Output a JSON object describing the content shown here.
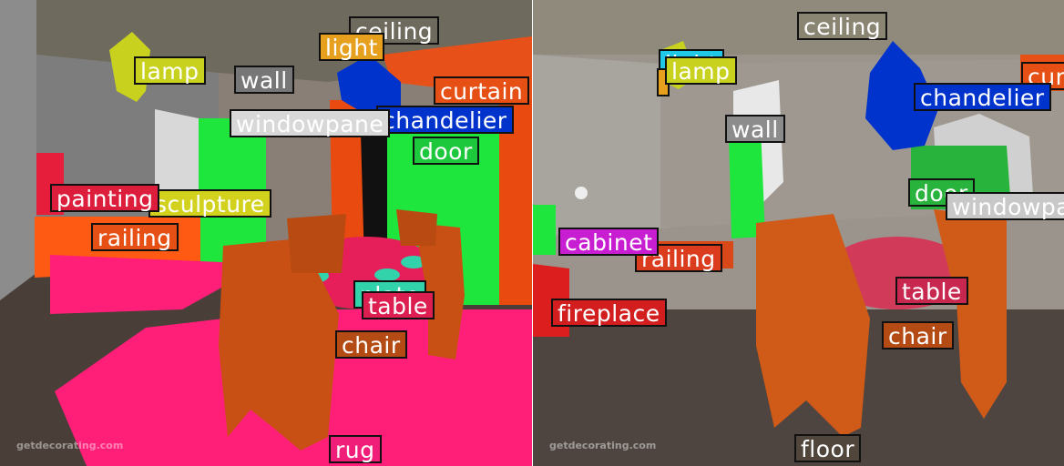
{
  "watermark": "getdecorating.com",
  "colors": {
    "ceiling": "#6e6b5e",
    "lamp": "#c8d21e",
    "wall": "#8c8c8c",
    "light": "#e6a01e",
    "curtain": "#ff5014",
    "windowpane": "#e6e6e6",
    "chandelier": "#0033cc",
    "door": "#1ee63c",
    "painting": "#e61e3c",
    "sculpture": "#e6e61e",
    "railing": "#ff5a14",
    "table": "#e61e5a",
    "plate": "#32d2aa",
    "chair": "#c85014",
    "rug": "#ff1e78",
    "cabinet": "#c81ed2",
    "fireplace": "#dc1e1e",
    "floor": "#50463c"
  },
  "left_panel": {
    "labels": {
      "ceiling": "ceiling",
      "light": "light",
      "lamp": "lamp",
      "wall": "wall",
      "curtain": "curtain",
      "windowpane": "windowpane",
      "chandelier": "chandelier",
      "door": "door",
      "painting": "painting",
      "sculpture": "sculpture",
      "railing": "railing",
      "plate": "plate",
      "table": "table",
      "chair": "chair",
      "rug": "rug"
    }
  },
  "right_panel": {
    "labels": {
      "ceiling": "ceiling",
      "light": "light",
      "lamp": "lamp",
      "wall": "wall",
      "curtain": "curtain",
      "chandelier": "chandelier",
      "door": "door",
      "windowpane": "windowpane",
      "cabinet": "cabinet",
      "railing": "railing",
      "fireplace": "fireplace",
      "table": "table",
      "chair": "chair",
      "floor": "floor"
    }
  }
}
